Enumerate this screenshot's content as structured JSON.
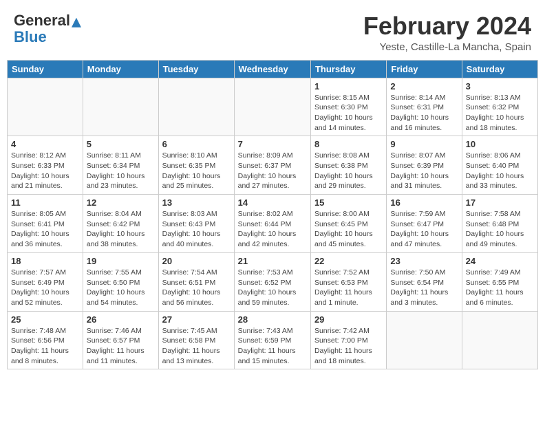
{
  "header": {
    "logo_general": "General",
    "logo_blue": "Blue",
    "title": "February 2024",
    "subtitle": "Yeste, Castille-La Mancha, Spain"
  },
  "days_of_week": [
    "Sunday",
    "Monday",
    "Tuesday",
    "Wednesday",
    "Thursday",
    "Friday",
    "Saturday"
  ],
  "weeks": [
    [
      {
        "day": "",
        "info": ""
      },
      {
        "day": "",
        "info": ""
      },
      {
        "day": "",
        "info": ""
      },
      {
        "day": "",
        "info": ""
      },
      {
        "day": "1",
        "info": "Sunrise: 8:15 AM\nSunset: 6:30 PM\nDaylight: 10 hours and 14 minutes."
      },
      {
        "day": "2",
        "info": "Sunrise: 8:14 AM\nSunset: 6:31 PM\nDaylight: 10 hours and 16 minutes."
      },
      {
        "day": "3",
        "info": "Sunrise: 8:13 AM\nSunset: 6:32 PM\nDaylight: 10 hours and 18 minutes."
      }
    ],
    [
      {
        "day": "4",
        "info": "Sunrise: 8:12 AM\nSunset: 6:33 PM\nDaylight: 10 hours and 21 minutes."
      },
      {
        "day": "5",
        "info": "Sunrise: 8:11 AM\nSunset: 6:34 PM\nDaylight: 10 hours and 23 minutes."
      },
      {
        "day": "6",
        "info": "Sunrise: 8:10 AM\nSunset: 6:35 PM\nDaylight: 10 hours and 25 minutes."
      },
      {
        "day": "7",
        "info": "Sunrise: 8:09 AM\nSunset: 6:37 PM\nDaylight: 10 hours and 27 minutes."
      },
      {
        "day": "8",
        "info": "Sunrise: 8:08 AM\nSunset: 6:38 PM\nDaylight: 10 hours and 29 minutes."
      },
      {
        "day": "9",
        "info": "Sunrise: 8:07 AM\nSunset: 6:39 PM\nDaylight: 10 hours and 31 minutes."
      },
      {
        "day": "10",
        "info": "Sunrise: 8:06 AM\nSunset: 6:40 PM\nDaylight: 10 hours and 33 minutes."
      }
    ],
    [
      {
        "day": "11",
        "info": "Sunrise: 8:05 AM\nSunset: 6:41 PM\nDaylight: 10 hours and 36 minutes."
      },
      {
        "day": "12",
        "info": "Sunrise: 8:04 AM\nSunset: 6:42 PM\nDaylight: 10 hours and 38 minutes."
      },
      {
        "day": "13",
        "info": "Sunrise: 8:03 AM\nSunset: 6:43 PM\nDaylight: 10 hours and 40 minutes."
      },
      {
        "day": "14",
        "info": "Sunrise: 8:02 AM\nSunset: 6:44 PM\nDaylight: 10 hours and 42 minutes."
      },
      {
        "day": "15",
        "info": "Sunrise: 8:00 AM\nSunset: 6:45 PM\nDaylight: 10 hours and 45 minutes."
      },
      {
        "day": "16",
        "info": "Sunrise: 7:59 AM\nSunset: 6:47 PM\nDaylight: 10 hours and 47 minutes."
      },
      {
        "day": "17",
        "info": "Sunrise: 7:58 AM\nSunset: 6:48 PM\nDaylight: 10 hours and 49 minutes."
      }
    ],
    [
      {
        "day": "18",
        "info": "Sunrise: 7:57 AM\nSunset: 6:49 PM\nDaylight: 10 hours and 52 minutes."
      },
      {
        "day": "19",
        "info": "Sunrise: 7:55 AM\nSunset: 6:50 PM\nDaylight: 10 hours and 54 minutes."
      },
      {
        "day": "20",
        "info": "Sunrise: 7:54 AM\nSunset: 6:51 PM\nDaylight: 10 hours and 56 minutes."
      },
      {
        "day": "21",
        "info": "Sunrise: 7:53 AM\nSunset: 6:52 PM\nDaylight: 10 hours and 59 minutes."
      },
      {
        "day": "22",
        "info": "Sunrise: 7:52 AM\nSunset: 6:53 PM\nDaylight: 11 hours and 1 minute."
      },
      {
        "day": "23",
        "info": "Sunrise: 7:50 AM\nSunset: 6:54 PM\nDaylight: 11 hours and 3 minutes."
      },
      {
        "day": "24",
        "info": "Sunrise: 7:49 AM\nSunset: 6:55 PM\nDaylight: 11 hours and 6 minutes."
      }
    ],
    [
      {
        "day": "25",
        "info": "Sunrise: 7:48 AM\nSunset: 6:56 PM\nDaylight: 11 hours and 8 minutes."
      },
      {
        "day": "26",
        "info": "Sunrise: 7:46 AM\nSunset: 6:57 PM\nDaylight: 11 hours and 11 minutes."
      },
      {
        "day": "27",
        "info": "Sunrise: 7:45 AM\nSunset: 6:58 PM\nDaylight: 11 hours and 13 minutes."
      },
      {
        "day": "28",
        "info": "Sunrise: 7:43 AM\nSunset: 6:59 PM\nDaylight: 11 hours and 15 minutes."
      },
      {
        "day": "29",
        "info": "Sunrise: 7:42 AM\nSunset: 7:00 PM\nDaylight: 11 hours and 18 minutes."
      },
      {
        "day": "",
        "info": ""
      },
      {
        "day": "",
        "info": ""
      }
    ]
  ]
}
